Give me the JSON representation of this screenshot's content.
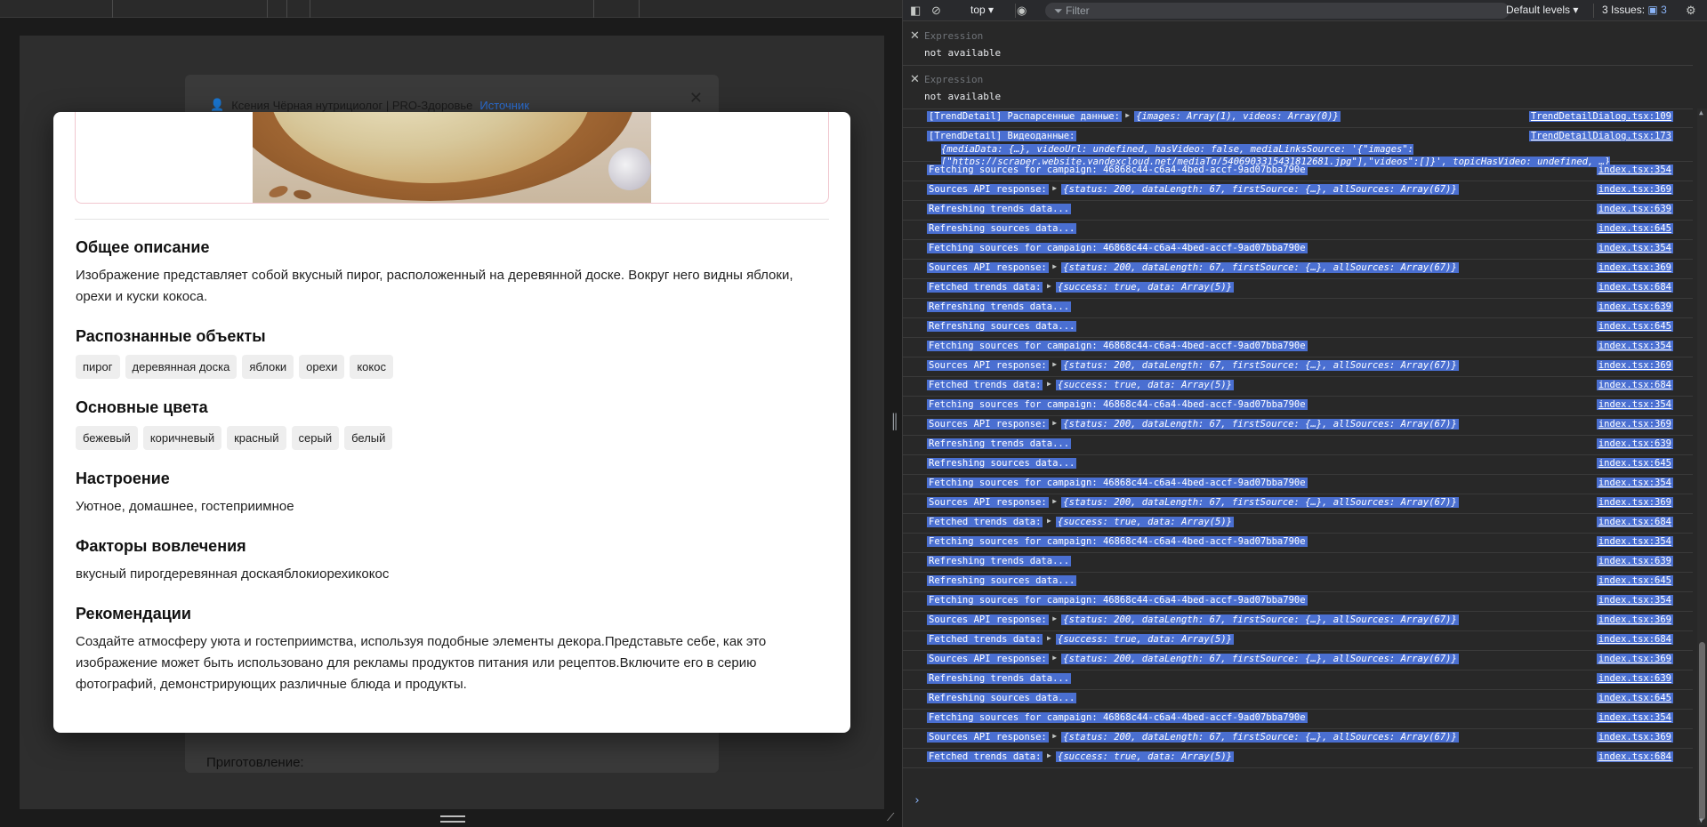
{
  "page": {
    "bg_dialog": {
      "author": "Ксения Чёрная нутрициолог | PRO-Здоровье",
      "source_link": "Источник",
      "preparation": "Приготовление:"
    },
    "modal": {
      "sections": [
        {
          "title": "Общее описание",
          "text": "Изображение представляет собой вкусный пирог, расположенный на деревянной доске. Вокруг него видны яблоки, орехи и куски кокоса."
        },
        {
          "title": "Распознанные объекты",
          "chips": [
            "пирог",
            "деревянная доска",
            "яблоки",
            "орехи",
            "кокос"
          ]
        },
        {
          "title": "Основные цвета",
          "chips": [
            "бежевый",
            "коричневый",
            "красный",
            "серый",
            "белый"
          ]
        },
        {
          "title": "Настроение",
          "text": "Уютное, домашнее, гостеприимное"
        },
        {
          "title": "Факторы вовлечения",
          "text": "вкусный пирогдеревянная доскаяблокиорехикокос"
        },
        {
          "title": "Рекомендации",
          "text": "Создайте атмосферу уюта и гостеприимства, используя подобные элементы декора.Представьте себе, как это изображение может быть использовано для рекламы продуктов питания или рецептов.Включите его в серию фотографий, демонстрирующих различные блюда и продукты."
        }
      ]
    }
  },
  "devtools": {
    "toolbar": {
      "context": "top ▾",
      "filter_placeholder": "Filter",
      "levels": "Default levels ▾",
      "issues_label": "3 Issues:",
      "issues_count": "3"
    },
    "expressions": [
      {
        "label": "Expression",
        "value": "not available"
      },
      {
        "label": "Expression",
        "value": "not available"
      }
    ],
    "console": [
      {
        "msg": "[TrendDetail] Распарсенные данные:",
        "obj": "{images: Array(1), videos: Array(0)}",
        "src": "TrendDetailDialog.tsx:109"
      },
      {
        "msg": "[TrendDetail] Видеоданные:",
        "obj": "",
        "src": "TrendDetailDialog.tsx:173",
        "wrap": "{mediaData: {…}, videoUrl: undefined, hasVideo: false, mediaLinksSource: '{\"images\":[\"https://scraper.website.yandexcloud.net/mediaTg/5406903315431812681.jpg\"],\"videos\":[]}', topicHasVideo: undefined, …}"
      },
      {
        "msg": "Fetching sources for campaign: 46868c44-c6a4-4bed-accf-9ad07bba790e",
        "obj": "",
        "src": "index.tsx:354"
      },
      {
        "msg": "Sources API response:",
        "obj": "{status: 200, dataLength: 67, firstSource: {…}, allSources: Array(67)}",
        "src": "index.tsx:369"
      },
      {
        "msg": "Refreshing trends data...",
        "obj": "",
        "src": "index.tsx:639"
      },
      {
        "msg": "Refreshing sources data...",
        "obj": "",
        "src": "index.tsx:645"
      },
      {
        "msg": "Fetching sources for campaign: 46868c44-c6a4-4bed-accf-9ad07bba790e",
        "obj": "",
        "src": "index.tsx:354"
      },
      {
        "msg": "Sources API response:",
        "obj": "{status: 200, dataLength: 67, firstSource: {…}, allSources: Array(67)}",
        "src": "index.tsx:369"
      },
      {
        "msg": "Fetched trends data:",
        "obj": "{success: true, data: Array(5)}",
        "src": "index.tsx:684"
      },
      {
        "msg": "Refreshing trends data...",
        "obj": "",
        "src": "index.tsx:639"
      },
      {
        "msg": "Refreshing sources data...",
        "obj": "",
        "src": "index.tsx:645"
      },
      {
        "msg": "Fetching sources for campaign: 46868c44-c6a4-4bed-accf-9ad07bba790e",
        "obj": "",
        "src": "index.tsx:354"
      },
      {
        "msg": "Sources API response:",
        "obj": "{status: 200, dataLength: 67, firstSource: {…}, allSources: Array(67)}",
        "src": "index.tsx:369"
      },
      {
        "msg": "Fetched trends data:",
        "obj": "{success: true, data: Array(5)}",
        "src": "index.tsx:684"
      },
      {
        "msg": "Fetching sources for campaign: 46868c44-c6a4-4bed-accf-9ad07bba790e",
        "obj": "",
        "src": "index.tsx:354"
      },
      {
        "msg": "Sources API response:",
        "obj": "{status: 200, dataLength: 67, firstSource: {…}, allSources: Array(67)}",
        "src": "index.tsx:369"
      },
      {
        "msg": "Refreshing trends data...",
        "obj": "",
        "src": "index.tsx:639"
      },
      {
        "msg": "Refreshing sources data...",
        "obj": "",
        "src": "index.tsx:645"
      },
      {
        "msg": "Fetching sources for campaign: 46868c44-c6a4-4bed-accf-9ad07bba790e",
        "obj": "",
        "src": "index.tsx:354"
      },
      {
        "msg": "Sources API response:",
        "obj": "{status: 200, dataLength: 67, firstSource: {…}, allSources: Array(67)}",
        "src": "index.tsx:369"
      },
      {
        "msg": "Fetched trends data:",
        "obj": "{success: true, data: Array(5)}",
        "src": "index.tsx:684"
      },
      {
        "msg": "Fetching sources for campaign: 46868c44-c6a4-4bed-accf-9ad07bba790e",
        "obj": "",
        "src": "index.tsx:354"
      },
      {
        "msg": "Refreshing trends data...",
        "obj": "",
        "src": "index.tsx:639"
      },
      {
        "msg": "Refreshing sources data...",
        "obj": "",
        "src": "index.tsx:645"
      },
      {
        "msg": "Fetching sources for campaign: 46868c44-c6a4-4bed-accf-9ad07bba790e",
        "obj": "",
        "src": "index.tsx:354"
      },
      {
        "msg": "Sources API response:",
        "obj": "{status: 200, dataLength: 67, firstSource: {…}, allSources: Array(67)}",
        "src": "index.tsx:369"
      },
      {
        "msg": "Fetched trends data:",
        "obj": "{success: true, data: Array(5)}",
        "src": "index.tsx:684"
      },
      {
        "msg": "Sources API response:",
        "obj": "{status: 200, dataLength: 67, firstSource: {…}, allSources: Array(67)}",
        "src": "index.tsx:369"
      },
      {
        "msg": "Refreshing trends data...",
        "obj": "",
        "src": "index.tsx:639"
      },
      {
        "msg": "Refreshing sources data...",
        "obj": "",
        "src": "index.tsx:645"
      },
      {
        "msg": "Fetching sources for campaign: 46868c44-c6a4-4bed-accf-9ad07bba790e",
        "obj": "",
        "src": "index.tsx:354"
      },
      {
        "msg": "Sources API response:",
        "obj": "{status: 200, dataLength: 67, firstSource: {…}, allSources: Array(67)}",
        "src": "index.tsx:369"
      },
      {
        "msg": "Fetched trends data:",
        "obj": "{success: true, data: Array(5)}",
        "src": "index.tsx:684"
      }
    ],
    "prompt": "›"
  }
}
